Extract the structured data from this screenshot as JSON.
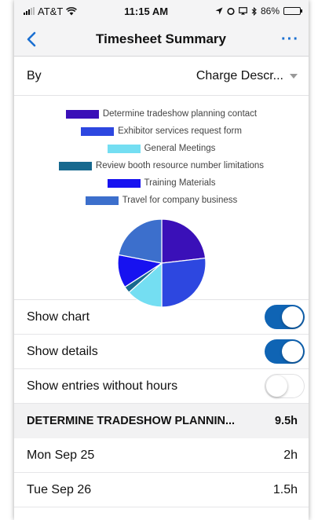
{
  "status_bar": {
    "carrier": "AT&T",
    "time": "11:15 AM",
    "battery": "86%"
  },
  "nav": {
    "title": "Timesheet Summary",
    "more": "···"
  },
  "group_by": {
    "label": "By",
    "value": "Charge Descr..."
  },
  "colors": {
    "accent": "#0f64b4",
    "nav_tint": "#1a6fd1"
  },
  "chart_data": {
    "type": "pie",
    "legend_placement": "top",
    "categories": [
      "Determine tradeshow planning contact",
      "Exhibitor services request form",
      "General Meetings",
      "Review booth resource number limitations",
      "Training Materials",
      "Travel for company business"
    ],
    "values": [
      9.5,
      11,
      5.5,
      1,
      5,
      9
    ],
    "colors": [
      "#3a10b8",
      "#2d47e0",
      "#74def2",
      "#17698f",
      "#1712f0",
      "#3c6fcc"
    ]
  },
  "toggles": [
    {
      "label": "Show chart",
      "on": true
    },
    {
      "label": "Show details",
      "on": true
    },
    {
      "label": "Show entries without hours",
      "on": false
    }
  ],
  "details": {
    "group_title": "DETERMINE TRADESHOW PLANNIN...",
    "group_total": "9.5h",
    "entries": [
      {
        "date": "Mon Sep 25",
        "hours": "2h"
      },
      {
        "date": "Tue Sep 26",
        "hours": "1.5h"
      }
    ]
  }
}
